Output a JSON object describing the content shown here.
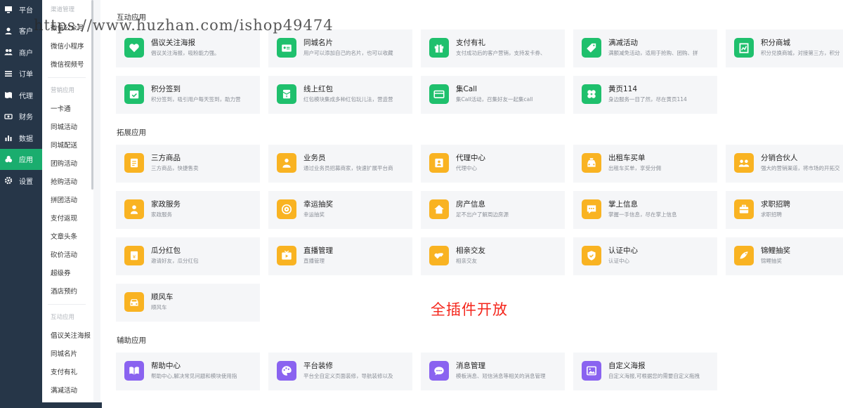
{
  "nav_primary": [
    {
      "label": "平台",
      "icon": "monitor-icon"
    },
    {
      "label": "客户",
      "icon": "user-icon"
    },
    {
      "label": "商户",
      "icon": "users-icon"
    },
    {
      "label": "订单",
      "icon": "list-icon"
    },
    {
      "label": "代理",
      "icon": "map-icon"
    },
    {
      "label": "财务",
      "icon": "money-icon"
    },
    {
      "label": "数据",
      "icon": "bar-chart-icon"
    },
    {
      "label": "应用",
      "icon": "apps-icon",
      "active": true
    },
    {
      "label": "设置",
      "icon": "gear-icon"
    }
  ],
  "nav_secondary": {
    "group1_title": "渠道管理",
    "group1_items": [
      "微信公众号",
      "微信小程序",
      "微信视频号"
    ],
    "group2_title": "营销应用",
    "group2_items": [
      "一卡通",
      "同城活动",
      "同城配送",
      "团购活动",
      "抢购活动",
      "拼团活动",
      "支付返现",
      "文章头条",
      "砍价活动",
      "超级券",
      "酒店预约"
    ],
    "group3_title": "互动应用",
    "group3_items": [
      "倡议关注海报",
      "同城名片",
      "支付有礼",
      "满减活动"
    ]
  },
  "watermark": "https://www.huzhan.com/ishop49474",
  "promo_text": "全插件开放",
  "sections": [
    {
      "title": "互动应用",
      "cards": [
        {
          "name": "倡议关注海报",
          "desc": "倡议关注海报，吸粉能力强。",
          "icon": "heart-icon",
          "color": "green"
        },
        {
          "name": "同城名片",
          "desc": "用户可以添加自己的名片，也可以收藏",
          "icon": "id-card-icon",
          "color": "green"
        },
        {
          "name": "支付有礼",
          "desc": "支付成功后的客户营销，支持发卡券、",
          "icon": "gift-icon",
          "color": "green"
        },
        {
          "name": "满减活动",
          "desc": "满额减免活动，适用于抢购、团购、拼",
          "icon": "tag-icon",
          "color": "green"
        },
        {
          "name": "积分商城",
          "desc": "积分兑换商城，对接第三方，积分",
          "icon": "shop-icon",
          "color": "green"
        },
        {
          "name": "积分签到",
          "desc": "积分签到，吸引用户每天签到，助力营",
          "icon": "calendar-check-icon",
          "color": "green"
        },
        {
          "name": "线上红包",
          "desc": "红包模块集成多种红包玩儿法，营造营",
          "icon": "red-packet-icon",
          "color": "green"
        },
        {
          "name": "集Call",
          "desc": "集Call活动，召集好友一起集call",
          "icon": "card-icon",
          "color": "green"
        },
        {
          "name": "黄页114",
          "desc": "身边服务一目了然，尽在黄页114",
          "icon": "clover-icon",
          "color": "green"
        }
      ]
    },
    {
      "title": "拓展应用",
      "cards": [
        {
          "name": "三方商品",
          "desc": "三方商品，快捷售卖",
          "icon": "document-icon",
          "color": "yellow"
        },
        {
          "name": "业务员",
          "desc": "通过业务员招募商家，快速扩展平台商",
          "icon": "salesman-icon",
          "color": "yellow"
        },
        {
          "name": "代理中心",
          "desc": "代理中心",
          "icon": "agent-icon",
          "color": "yellow"
        },
        {
          "name": "出租车买单",
          "desc": "出租车买单，享受分佣",
          "icon": "taxi-icon",
          "color": "yellow"
        },
        {
          "name": "分销合伙人",
          "desc": "强大的营销渠道，将市场的开拓交",
          "icon": "partners-icon",
          "color": "yellow"
        },
        {
          "name": "家政服务",
          "desc": "家政服务",
          "icon": "housekeeper-icon",
          "color": "yellow"
        },
        {
          "name": "幸运抽奖",
          "desc": "幸运抽奖",
          "icon": "lucky-wheel-icon",
          "color": "yellow"
        },
        {
          "name": "房产信息",
          "desc": "足不出户了解周边房源",
          "icon": "house-icon",
          "color": "yellow"
        },
        {
          "name": "掌上信息",
          "desc": "掌握一手信息，尽在掌上信息",
          "icon": "message-icon",
          "color": "yellow"
        },
        {
          "name": "求职招聘",
          "desc": "求职招聘",
          "icon": "briefcase-icon",
          "color": "yellow"
        },
        {
          "name": "瓜分红包",
          "desc": "邀请好友，瓜分红包",
          "icon": "split-packet-icon",
          "color": "yellow"
        },
        {
          "name": "直播管理",
          "desc": "直播管理",
          "icon": "live-tv-icon",
          "color": "yellow"
        },
        {
          "name": "相亲交友",
          "desc": "相亲交友",
          "icon": "hearts-icon",
          "color": "yellow"
        },
        {
          "name": "认证中心",
          "desc": "认证中心",
          "icon": "shield-check-icon",
          "color": "yellow"
        },
        {
          "name": "锦鲤抽奖",
          "desc": "锦鲤抽奖",
          "icon": "koi-icon",
          "color": "yellow"
        },
        {
          "name": "顺风车",
          "desc": "顺风车",
          "icon": "car-icon",
          "color": "yellow"
        }
      ]
    },
    {
      "title": "辅助应用",
      "cards": [
        {
          "name": "帮助中心",
          "desc": "帮助中心,解决常见问题和模块使用指",
          "icon": "book-icon",
          "color": "purple"
        },
        {
          "name": "平台装修",
          "desc": "平台全自定义页面装修，导航装修以及",
          "icon": "palette-icon",
          "color": "purple"
        },
        {
          "name": "消息管理",
          "desc": "模板消息、短信消息等相关的消息管理",
          "icon": "chat-icon",
          "color": "purple"
        },
        {
          "name": "自定义海报",
          "desc": "自定义海报,可根据您的需要自定义拖拽",
          "icon": "picture-icon",
          "color": "purple"
        }
      ]
    }
  ]
}
